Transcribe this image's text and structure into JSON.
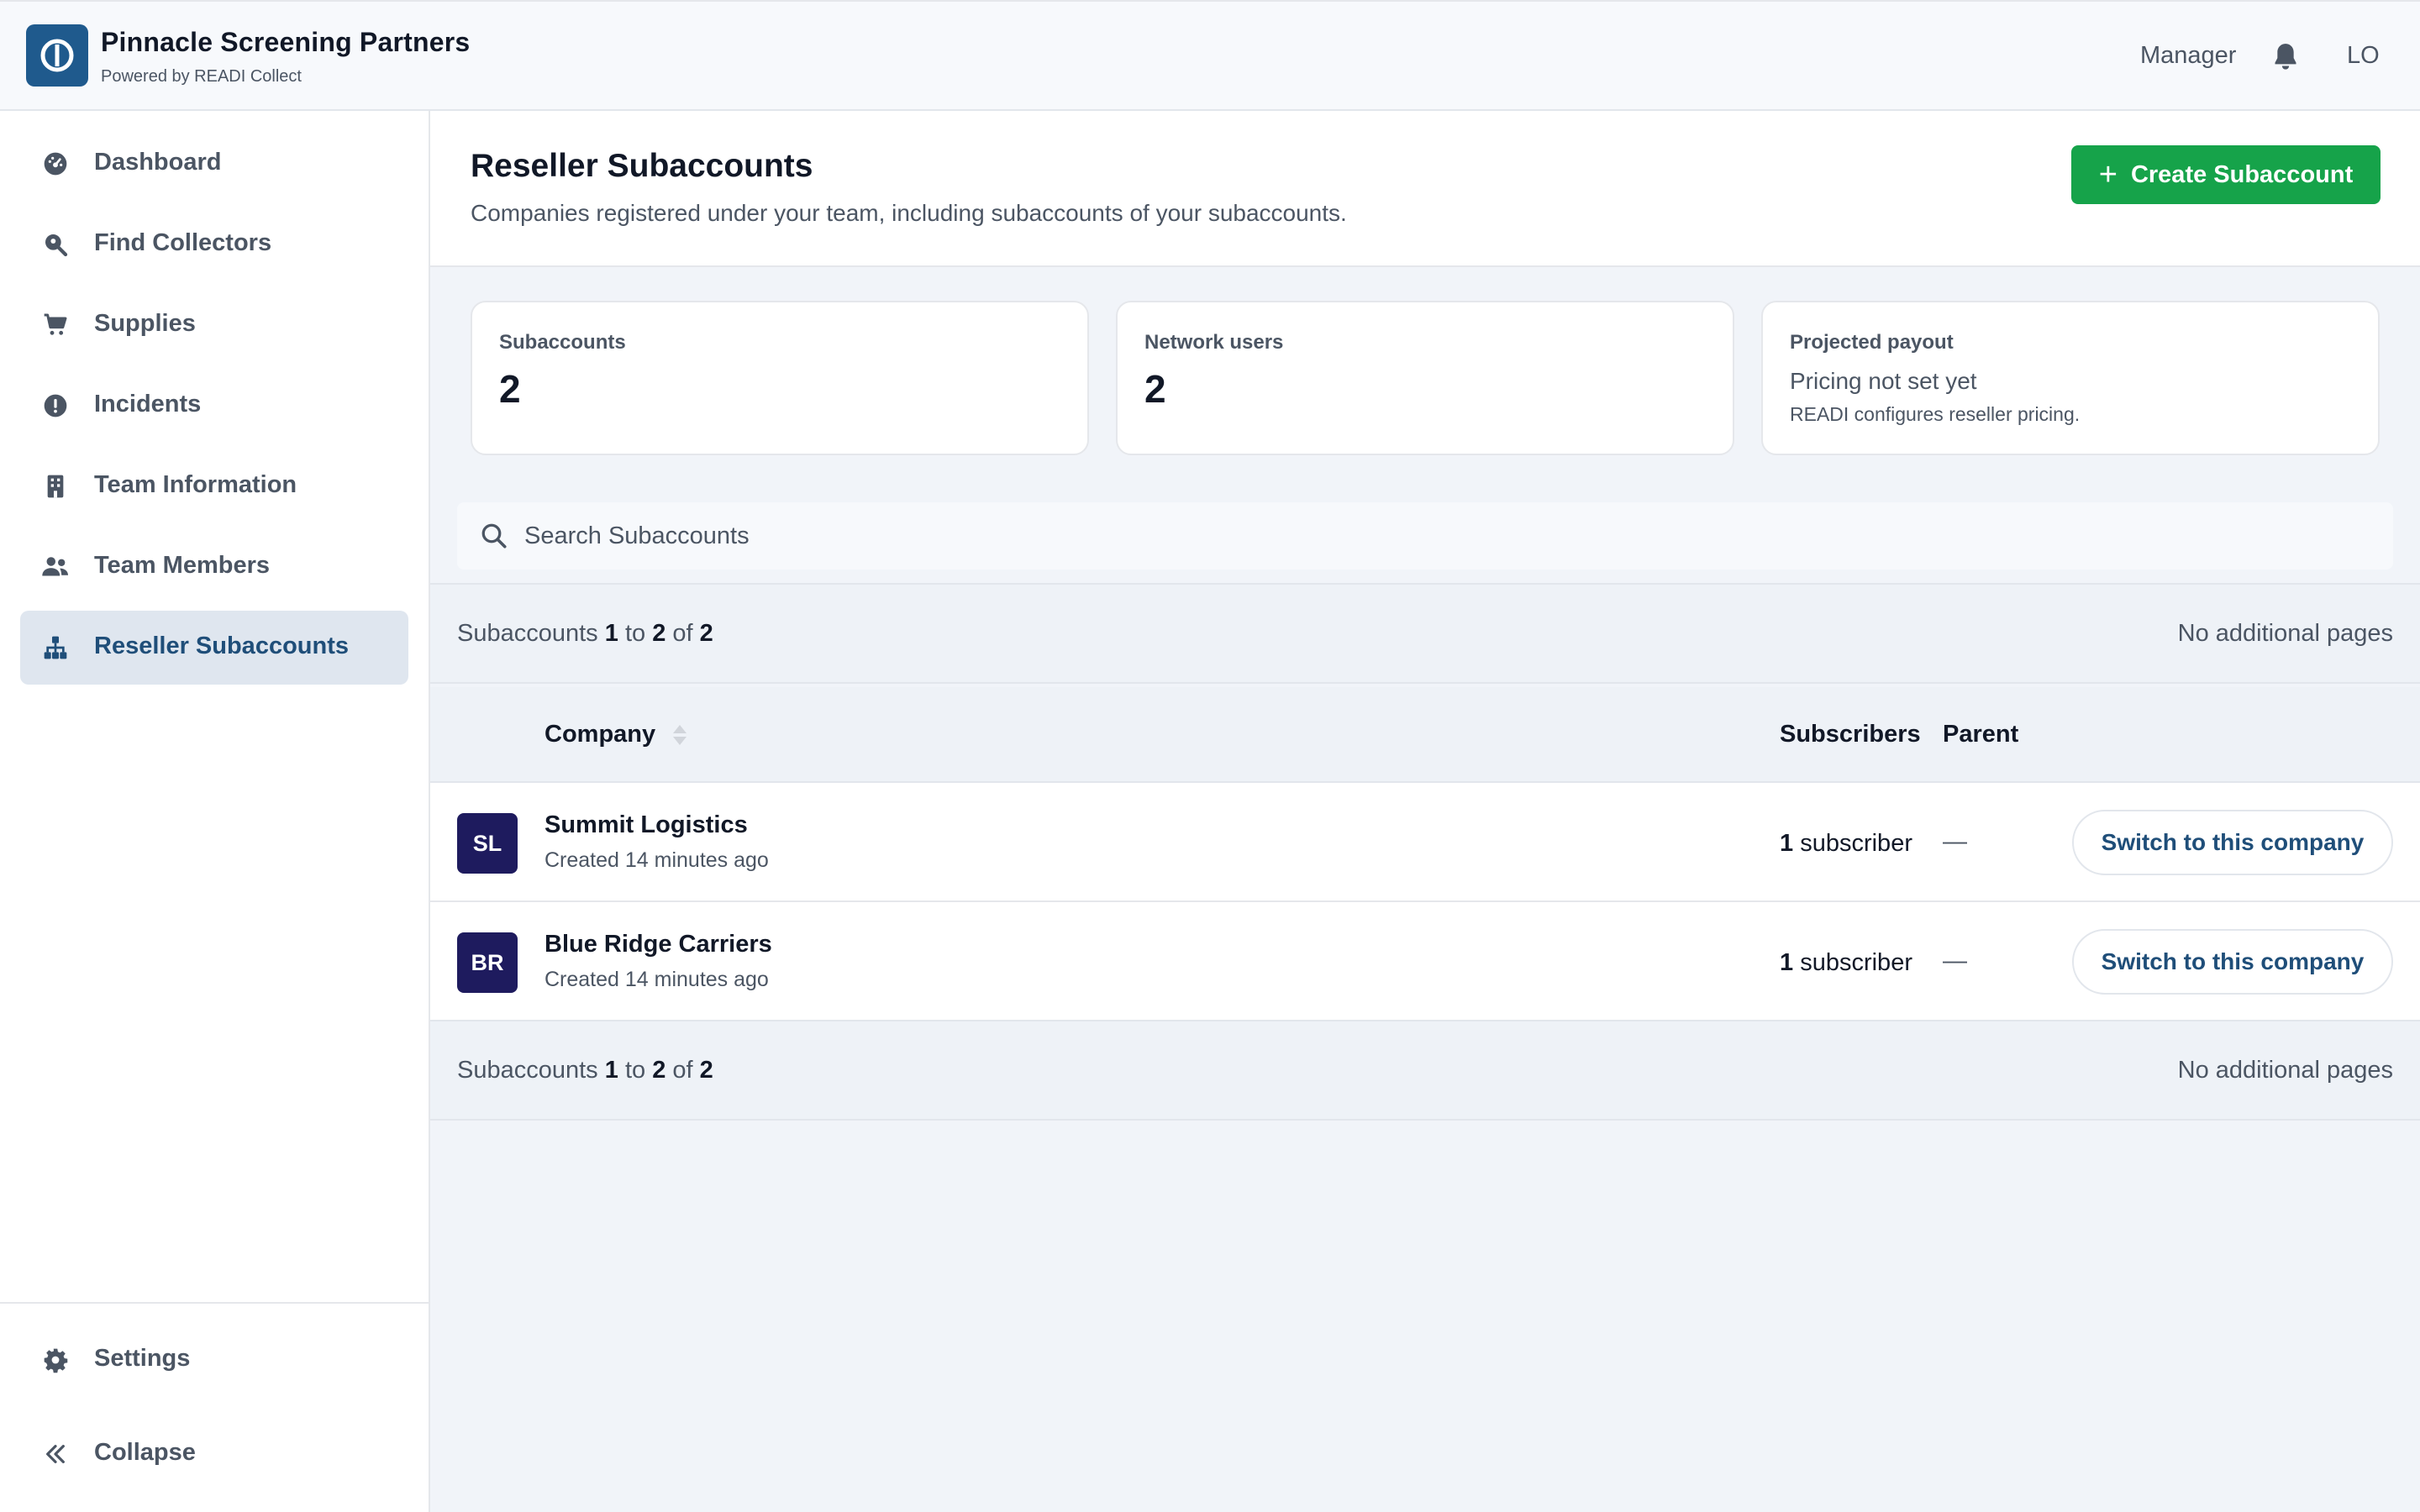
{
  "header": {
    "app_name": "Pinnacle Screening Partners",
    "app_subtitle": "Powered by READI Collect",
    "role": "Manager",
    "user_initials": "LO"
  },
  "sidebar": {
    "items": [
      {
        "label": "Dashboard",
        "icon": "dashboard-icon"
      },
      {
        "label": "Find Collectors",
        "icon": "search-location-icon"
      },
      {
        "label": "Supplies",
        "icon": "cart-icon"
      },
      {
        "label": "Incidents",
        "icon": "alert-circle-icon"
      },
      {
        "label": "Team Information",
        "icon": "building-icon"
      },
      {
        "label": "Team Members",
        "icon": "users-icon"
      },
      {
        "label": "Reseller Subaccounts",
        "icon": "hierarchy-icon",
        "active": true
      }
    ],
    "bottom": [
      {
        "label": "Settings",
        "icon": "gear-icon"
      },
      {
        "label": "Collapse",
        "icon": "double-chevron-left-icon"
      }
    ]
  },
  "page": {
    "title": "Reseller Subaccounts",
    "subtitle": "Companies registered under your team, including subaccounts of your subaccounts.",
    "create_label": "Create Subaccount"
  },
  "stats": {
    "subaccounts": {
      "label": "Subaccounts",
      "value": "2"
    },
    "network_users": {
      "label": "Network users",
      "value": "2"
    },
    "payout": {
      "label": "Projected payout",
      "value": "Pricing not set yet",
      "note": "READI configures reseller pricing."
    }
  },
  "search": {
    "placeholder": "Search Subaccounts",
    "value": ""
  },
  "pager": {
    "prefix": "Subaccounts",
    "from": "1",
    "to_word": "to",
    "to": "2",
    "of_word": "of",
    "total": "2",
    "status": "No additional pages"
  },
  "table": {
    "columns": {
      "company": "Company",
      "subscribers": "Subscribers",
      "parent": "Parent"
    },
    "rows": [
      {
        "initials": "SL",
        "name": "Summit Logistics",
        "created": "Created 14 minutes ago",
        "subscriber_count": "1",
        "subscriber_word": "subscriber",
        "parent": "—",
        "action": "Switch to this company"
      },
      {
        "initials": "BR",
        "name": "Blue Ridge Carriers",
        "created": "Created 14 minutes ago",
        "subscriber_count": "1",
        "subscriber_word": "subscriber",
        "parent": "—",
        "action": "Switch to this company"
      }
    ]
  },
  "colors": {
    "brand": "#1f5a8d",
    "primary_action": "#16a34a",
    "active_nav_bg": "#dfe6ef",
    "avatar_bg": "#1e1b5e",
    "link_text": "#1f4e79"
  }
}
